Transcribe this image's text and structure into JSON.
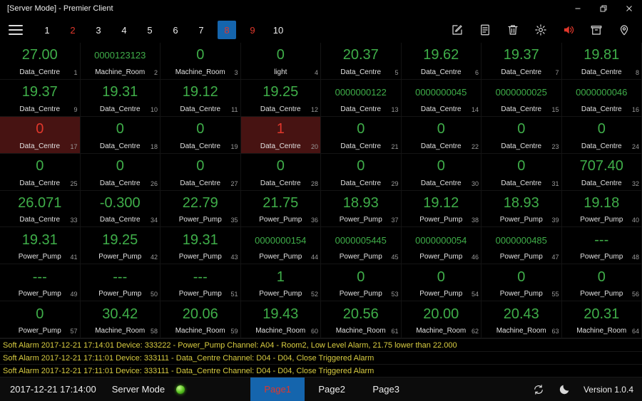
{
  "window": {
    "title": "[Server Mode] - Premier Client"
  },
  "toolbar": {
    "pages": [
      {
        "label": "1",
        "style": "normal"
      },
      {
        "label": "2",
        "style": "red"
      },
      {
        "label": "3",
        "style": "normal"
      },
      {
        "label": "4",
        "style": "normal"
      },
      {
        "label": "5",
        "style": "normal"
      },
      {
        "label": "6",
        "style": "normal"
      },
      {
        "label": "7",
        "style": "normal"
      },
      {
        "label": "8",
        "style": "active"
      },
      {
        "label": "9",
        "style": "red"
      },
      {
        "label": "10",
        "style": "normal"
      }
    ],
    "icons": [
      "edit-icon",
      "note-icon",
      "trash-icon",
      "settings-icon",
      "speaker-icon",
      "bin-icon",
      "location-icon"
    ]
  },
  "grid": {
    "cells": [
      [
        "27.00",
        "Data_Centre",
        0
      ],
      [
        "0000123123",
        "Machine_Room",
        0
      ],
      [
        "0",
        "Machine_Room",
        0
      ],
      [
        "0",
        "light",
        0
      ],
      [
        "20.37",
        "Data_Centre",
        0
      ],
      [
        "19.62",
        "Data_Centre",
        0
      ],
      [
        "19.37",
        "Data_Centre",
        0
      ],
      [
        "19.81",
        "Data_Centre",
        0
      ],
      [
        "19.37",
        "Data_Centre",
        0
      ],
      [
        "19.31",
        "Data_Centre",
        0
      ],
      [
        "19.12",
        "Data_Centre",
        0
      ],
      [
        "19.25",
        "Data_Centre",
        0
      ],
      [
        "0000000122",
        "Data_Centre",
        0
      ],
      [
        "0000000045",
        "Data_Centre",
        0
      ],
      [
        "0000000025",
        "Data_Centre",
        0
      ],
      [
        "0000000046",
        "Data_Centre",
        0
      ],
      [
        "0",
        "Data_Centre",
        1
      ],
      [
        "0",
        "Data_Centre",
        0
      ],
      [
        "0",
        "Data_Centre",
        0
      ],
      [
        "1",
        "Data_Centre",
        1
      ],
      [
        "0",
        "Data_Centre",
        0
      ],
      [
        "0",
        "Data_Centre",
        0
      ],
      [
        "0",
        "Data_Centre",
        0
      ],
      [
        "0",
        "Data_Centre",
        0
      ],
      [
        "0",
        "Data_Centre",
        0
      ],
      [
        "0",
        "Data_Centre",
        0
      ],
      [
        "0",
        "Data_Centre",
        0
      ],
      [
        "0",
        "Data_Centre",
        0
      ],
      [
        "0",
        "Data_Centre",
        0
      ],
      [
        "0",
        "Data_Centre",
        0
      ],
      [
        "0",
        "Data_Centre",
        0
      ],
      [
        "707.40",
        "Data_Centre",
        0
      ],
      [
        "26.071",
        "Data_Centre",
        0
      ],
      [
        "-0.300",
        "Data_Centre",
        0
      ],
      [
        "22.79",
        "Power_Pump",
        0
      ],
      [
        "21.75",
        "Power_Pump",
        0
      ],
      [
        "18.93",
        "Power_Pump",
        0
      ],
      [
        "19.12",
        "Power_Pump",
        0
      ],
      [
        "18.93",
        "Power_Pump",
        0
      ],
      [
        "19.18",
        "Power_Pump",
        0
      ],
      [
        "19.31",
        "Power_Pump",
        0
      ],
      [
        "19.25",
        "Power_Pump",
        0
      ],
      [
        "19.31",
        "Power_Pump",
        0
      ],
      [
        "0000000154",
        "Power_Pump",
        0
      ],
      [
        "0000005445",
        "Power_Pump",
        0
      ],
      [
        "0000000054",
        "Power_Pump",
        0
      ],
      [
        "0000000485",
        "Power_Pump",
        0
      ],
      [
        "---",
        "Power_Pump",
        0
      ],
      [
        "---",
        "Power_Pump",
        0
      ],
      [
        "---",
        "Power_Pump",
        0
      ],
      [
        "---",
        "Power_Pump",
        0
      ],
      [
        "1",
        "Power_Pump",
        0
      ],
      [
        "0",
        "Power_Pump",
        0
      ],
      [
        "0",
        "Power_Pump",
        0
      ],
      [
        "0",
        "Power_Pump",
        0
      ],
      [
        "0",
        "Power_Pump",
        0
      ],
      [
        "0",
        "Power_Pump",
        0
      ],
      [
        "30.42",
        "Machine_Room",
        0
      ],
      [
        "20.06",
        "Machine_Room",
        0
      ],
      [
        "19.43",
        "Machine_Room",
        0
      ],
      [
        "20.56",
        "Machine_Room",
        0
      ],
      [
        "20.00",
        "Machine_Room",
        0
      ],
      [
        "20.43",
        "Machine_Room",
        0
      ],
      [
        "20.31",
        "Machine_Room",
        0
      ]
    ]
  },
  "alarms": [
    "Soft Alarm 2017-12-21 17:14:01 Device: 333222 - Power_Pump Channel: A04 - Room2, Low Level Alarm, 21.75 lower than 22.000",
    "Soft Alarm 2017-12-21 17:11:01 Device: 333111 - Data_Centre Channel: D04 - D04, Close Triggered Alarm",
    "Soft Alarm 2017-12-21 17:11:01 Device: 333111 - Data_Centre Channel: D04 - D04, Close Triggered Alarm"
  ],
  "statusbar": {
    "time": "2017-12-21 17:14:00",
    "mode_label": "Server Mode",
    "pages": [
      {
        "label": "Page1",
        "active": true
      },
      {
        "label": "Page2",
        "active": false
      },
      {
        "label": "Page3",
        "active": false
      }
    ],
    "version": "Version 1.0.4"
  },
  "colors": {
    "value_green": "#3fae49",
    "alarm_red": "#e0372b",
    "alarm_cell_bg": "#471312",
    "accent_blue": "#1565ad",
    "alarm_text_yellow": "#d9cd41"
  }
}
